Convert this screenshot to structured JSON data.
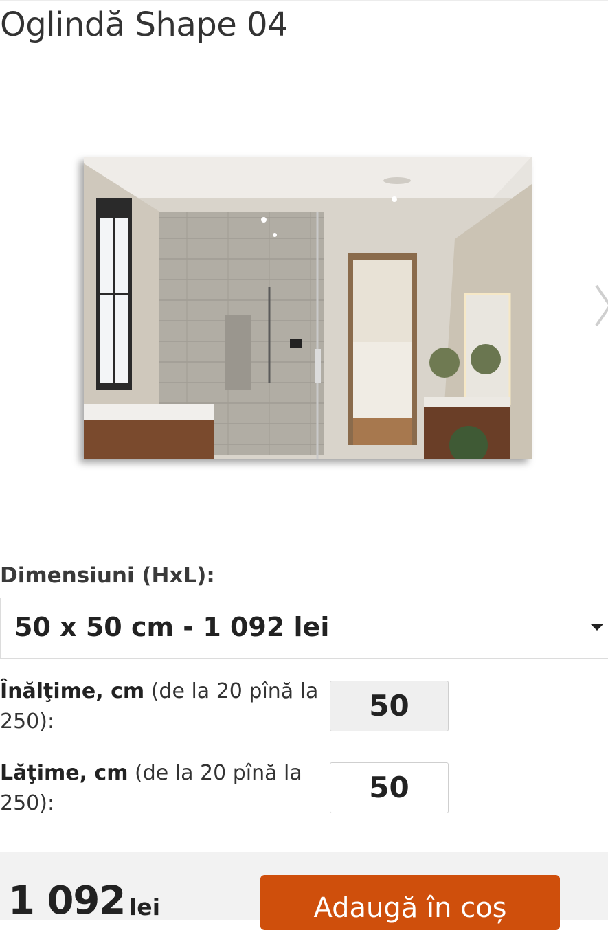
{
  "product": {
    "title": "Oglindă Shape 04"
  },
  "gallery": {
    "image": "bathroom-mirror-photo",
    "next_icon": "chevron-right-icon"
  },
  "dimensions": {
    "label": "Dimensiuni (HxL):",
    "selected": "50 x 50 cm - 1 092 lei",
    "caret_icon": "caret-down-icon"
  },
  "height_field": {
    "label_bold": "Înălţime, cm",
    "label_rest": " (de la 20 pînă la 250):",
    "value": "50"
  },
  "width_field": {
    "label_bold": "Lăţime, cm",
    "label_rest": " (de la 20 pînă la 250):",
    "value": "50"
  },
  "purchase": {
    "price": "1 092",
    "currency": "lei",
    "add_to_cart_label": "Adaugă în coș",
    "button_color": "#cf4f0c"
  }
}
